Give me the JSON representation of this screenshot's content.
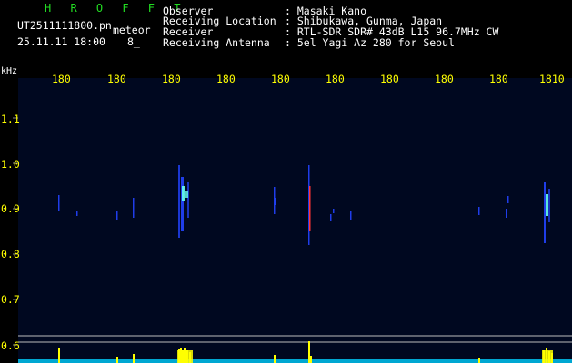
{
  "header": {
    "software": "H R O F F T",
    "filename": "UT2511111800.pn",
    "tag": "meteor",
    "timestamp": "25.11.11 18:00",
    "count": "8_",
    "observer_label": "Observer",
    "observer_value": ": Masaki Kano",
    "location_label": "Receiving Location",
    "location_value": ": Shibukawa, Gunma, Japan",
    "receiver_label": "Receiver",
    "receiver_value": ": RTL-SDR SDR# 43dB L15 96.7MHz CW",
    "antenna_label": "Receiving Antenna",
    "antenna_value": ": 5el Yagi Az 280 for Seoul"
  },
  "axis": {
    "unit_label": "kHz",
    "x_ticks": [
      "180",
      "180",
      "180",
      "180",
      "180",
      "180",
      "180",
      "180",
      "180",
      "1810"
    ],
    "y_ticks": [
      "1.1",
      "1.0",
      "0.9",
      "0.8",
      "0.7",
      "0.6"
    ]
  },
  "colors": {
    "background": "#000000",
    "plot_background": "#000820",
    "text": "#ffffff",
    "title": "#22dd22",
    "tick_labels": "#ffff00",
    "signal_core": "#66ffee",
    "signal_mid": "#2244ff",
    "signal_red": "#ff3333",
    "baseline": "#00d0ff"
  }
}
